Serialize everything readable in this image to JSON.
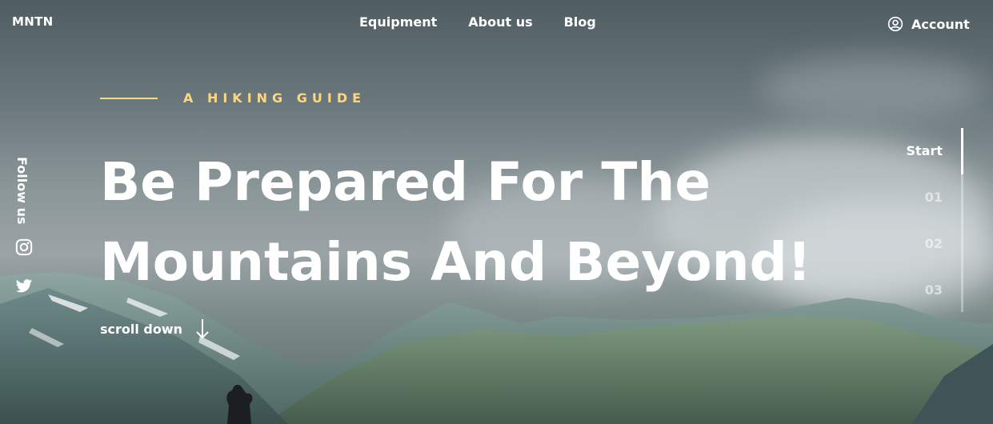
{
  "nav": {
    "logo": "MNTN",
    "links": [
      "Equipment",
      "About us",
      "Blog"
    ],
    "account_label": "Account"
  },
  "hero": {
    "eyebrow": "A HIKING GUIDE",
    "headline_line1": "Be Prepared For The",
    "headline_line2": "Mountains And Beyond!",
    "scroll_label": "scroll down"
  },
  "social": {
    "follow_label": "Follow us",
    "icons": [
      "instagram-icon",
      "twitter-icon"
    ]
  },
  "slider": {
    "items": [
      "Start",
      "01",
      "02",
      "03"
    ],
    "active_index": 0
  },
  "colors": {
    "accent": "#fbd784"
  }
}
